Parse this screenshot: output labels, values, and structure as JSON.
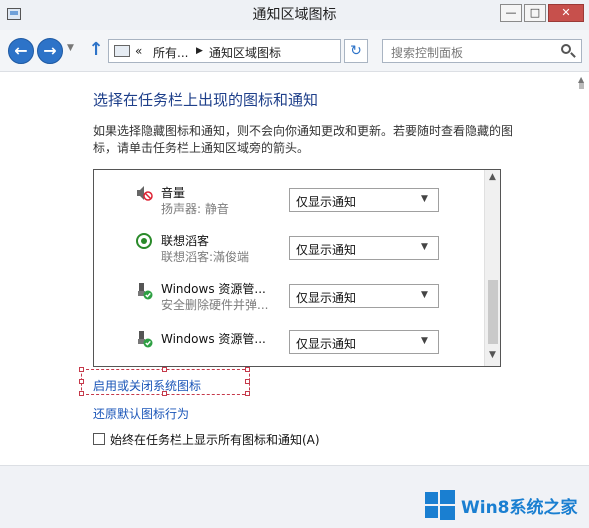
{
  "window": {
    "title": "通知区域图标",
    "min_glyph": "—",
    "max_glyph": "□",
    "close_glyph": "✕"
  },
  "nav": {
    "breadcrumb_more": "«",
    "breadcrumb_1": "所有...",
    "breadcrumb_sep": "▶",
    "breadcrumb_2": "通知区域图标",
    "search_placeholder": "搜索控制面板"
  },
  "main": {
    "heading": "选择在任务栏上出现的图标和通知",
    "description": "如果选择隐藏图标和通知，则不会向你通知更改和更新。若要随时查看隐藏的图标，请单击任务栏上通知区域旁的箭头。",
    "rows": [
      {
        "icon": "speaker-muted-icon",
        "name": "音量",
        "sub": "扬声器: 静音",
        "value": "仅显示通知"
      },
      {
        "icon": "lenovo-icon",
        "name": "联想滔客",
        "sub": "联想滔客:滿俊端",
        "value": "仅显示通知"
      },
      {
        "icon": "usb-safe-remove-icon",
        "name": "Windows 资源管...",
        "sub": "安全删除硬件并弹...",
        "value": "仅显示通知"
      },
      {
        "icon": "usb-safe-remove-icon",
        "name": "Windows 资源管...",
        "sub": "",
        "value": "仅显示通知"
      }
    ],
    "link_system_icons": "启用或关闭系统图标",
    "link_restore": "还原默认图标行为",
    "always_show_label": "始终在任务栏上显示所有图标和通知(A)",
    "always_show_checked": false
  },
  "watermark": {
    "text": "Win8系统之家"
  },
  "colors": {
    "accent": "#2d73c8",
    "link": "#1a55b8",
    "heading": "#1e3f8a",
    "selection_border": "#c5394a"
  }
}
